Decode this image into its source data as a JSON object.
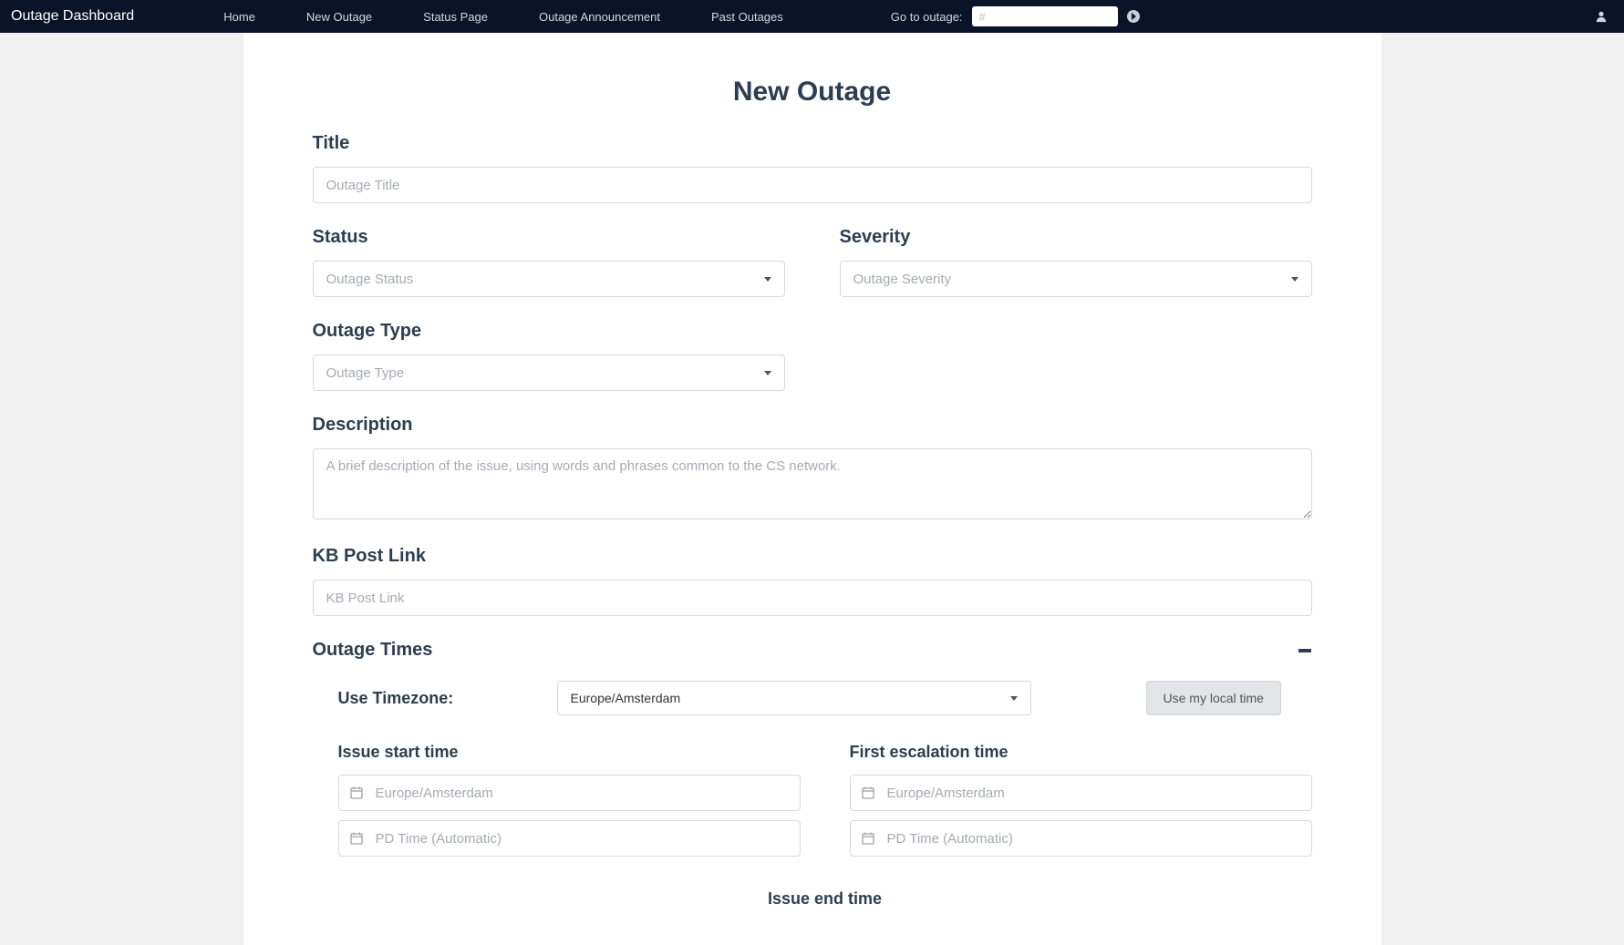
{
  "nav": {
    "brand": "Outage Dashboard",
    "links": [
      "Home",
      "New Outage",
      "Status Page",
      "Outage Announcement",
      "Past Outages"
    ],
    "goto_label": "Go to outage:",
    "goto_placeholder": "#"
  },
  "page": {
    "title": "New Outage"
  },
  "form": {
    "title": {
      "label": "Title",
      "placeholder": "Outage Title"
    },
    "status": {
      "label": "Status",
      "placeholder": "Outage Status"
    },
    "severity": {
      "label": "Severity",
      "placeholder": "Outage Severity"
    },
    "outage_type": {
      "label": "Outage Type",
      "placeholder": "Outage Type"
    },
    "description": {
      "label": "Description",
      "placeholder": "A brief description of the issue, using words and phrases common to the CS network."
    },
    "kb_post": {
      "label": "KB Post Link",
      "placeholder": "KB Post Link"
    },
    "times": {
      "section_label": "Outage Times",
      "tz_label": "Use Timezone:",
      "tz_value": "Europe/Amsterdam",
      "tz_button": "Use my local time",
      "start_label": "Issue start time",
      "escalation_label": "First escalation time",
      "end_label": "Issue end time",
      "tz_placeholder": "Europe/Amsterdam",
      "pd_placeholder": "PD Time (Automatic)"
    }
  }
}
